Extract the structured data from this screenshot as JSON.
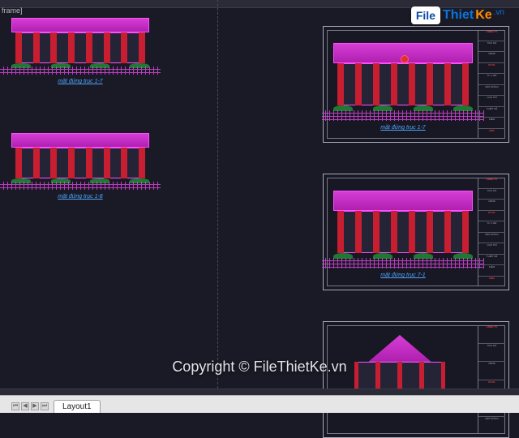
{
  "window": {
    "frame_label": "frame]"
  },
  "captions": {
    "elev1": "mặt đứng trục 1-7",
    "elev2": "mặt đứng trục 1-8",
    "sheet1": "mặt đứng trục 1-7",
    "sheet2": "mặt đứng trục 7-1"
  },
  "watermark": {
    "badge": "File",
    "word1": "Thiet",
    "word2": "Ke",
    "tld": ".vn",
    "copyright": "Copyright © FileThietKe.vn"
  },
  "tabs": {
    "nav_first": "⏮",
    "nav_prev": "◀",
    "nav_next": "▶",
    "nav_last": "⏭",
    "layout1": "Layout1"
  },
  "titleblock": {
    "rows": [
      "CÔNG TY",
      "TRỤ SỞ",
      "UBND",
      "KT-01",
      "TL 1:100",
      "MẶT ĐỨNG",
      "CHỦ TRÌ",
      "THIẾT KẾ",
      "KIỂM",
      "2021"
    ]
  }
}
